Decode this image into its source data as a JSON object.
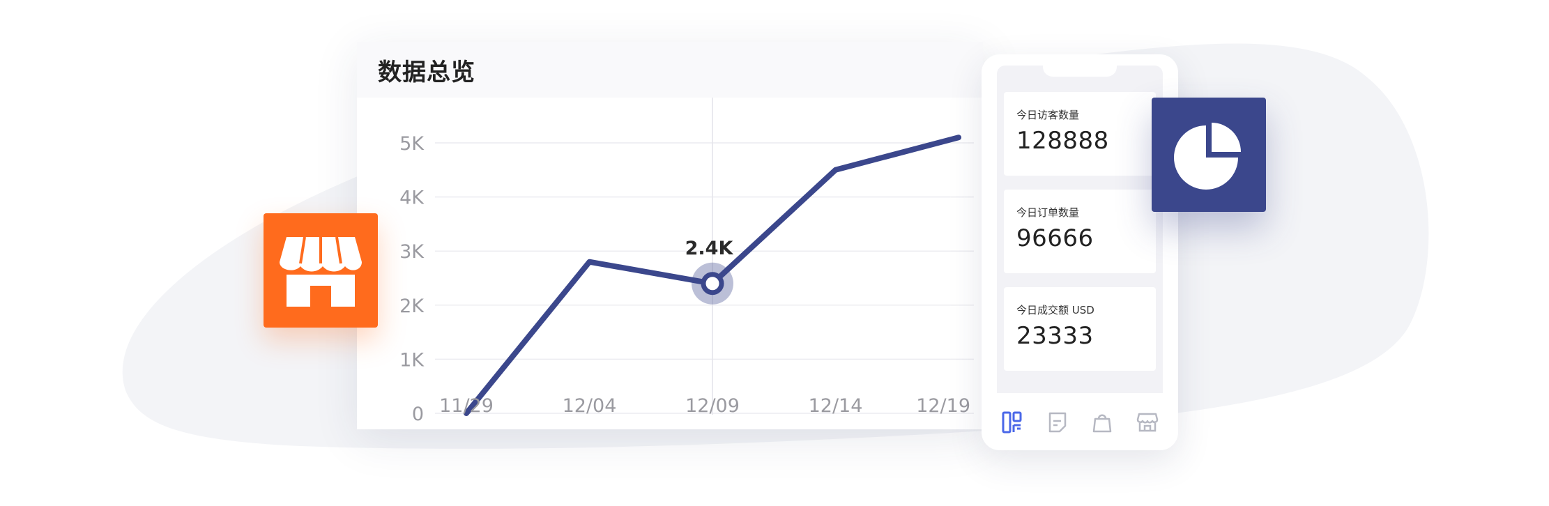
{
  "chart_card": {
    "title": "数据总览"
  },
  "chart_data": {
    "type": "line",
    "x": [
      "11/29",
      "12/04",
      "12/09",
      "12/14",
      "12/19"
    ],
    "series": [
      {
        "points": [
          {
            "x": "11/29",
            "y": 0
          },
          {
            "x": "12/04",
            "y": 2800
          },
          {
            "x": "12/09",
            "y": 2400
          },
          {
            "x": "12/14",
            "y": 4500
          },
          {
            "x": "12/19",
            "y": 5100
          }
        ],
        "color": "#3b478c"
      }
    ],
    "y_ticks": [
      "0",
      "1K",
      "2K",
      "3K",
      "4K",
      "5K"
    ],
    "ylim": [
      0,
      5000
    ],
    "highlight": {
      "x": "12/09",
      "y": 2400,
      "label": "2.4K"
    },
    "grid": "horizontal",
    "title": "",
    "xlabel": "",
    "ylabel": ""
  },
  "phone": {
    "stats": [
      {
        "label": "今日访客数量",
        "value": "128888"
      },
      {
        "label": "今日订单数量",
        "value": "96666"
      },
      {
        "label": "今日成交额 USD",
        "value": "23333"
      }
    ],
    "nav": [
      {
        "icon": "dashboard-icon",
        "active": true
      },
      {
        "icon": "document-icon",
        "active": false
      },
      {
        "icon": "shopping-bag-icon",
        "active": false
      },
      {
        "icon": "store-icon",
        "active": false
      }
    ]
  },
  "tiles": {
    "store_icon": "store-icon",
    "pie_icon": "pie-chart-icon"
  },
  "colors": {
    "accent_blue": "#3b478c",
    "accent_orange": "#ff6b1d",
    "nav_active": "#4a67e8",
    "nav_inactive": "#b6b8c2"
  }
}
